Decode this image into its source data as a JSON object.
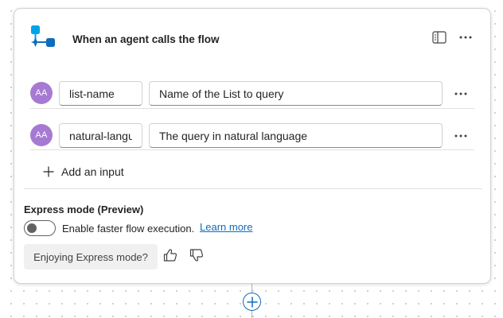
{
  "trigger": {
    "title": "When an agent calls the flow",
    "icon": "agent-trigger-icon",
    "accent_color": "#0f6cbd",
    "icon_color": "#00a2e8"
  },
  "header_actions": [
    {
      "icon": "side-panel-icon"
    },
    {
      "icon": "more-horizontal-icon"
    }
  ],
  "inputs": [
    {
      "avatar": "AA",
      "name": "list-name",
      "description": "Name of the List to query"
    },
    {
      "avatar": "AA",
      "name": "natural-langu",
      "description": "The query in natural language"
    }
  ],
  "add_input": {
    "label": "Add an input"
  },
  "express_mode": {
    "title": "Express mode (Preview)",
    "toggle_on": false,
    "toggle_label": "Enable faster flow execution.",
    "learn_more": "Learn more"
  },
  "feedback": {
    "label": "Enjoying Express mode?"
  },
  "colors": {
    "avatar": "#a67ad3",
    "link": "#0f6cbd"
  }
}
